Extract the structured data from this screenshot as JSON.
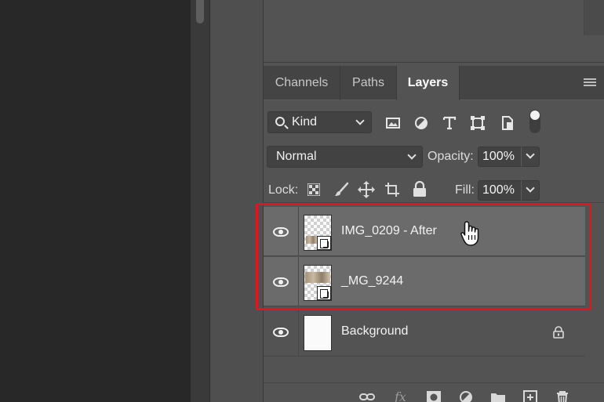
{
  "tabs": [
    {
      "label": "Channels",
      "active": false
    },
    {
      "label": "Paths",
      "active": false
    },
    {
      "label": "Layers",
      "active": true
    }
  ],
  "filter": {
    "kind_label": "Kind",
    "icons": [
      "image-filter-icon",
      "adjustment-filter-icon",
      "type-filter-icon",
      "shape-filter-icon",
      "smart-object-filter-icon"
    ]
  },
  "blend": {
    "mode": "Normal",
    "opacity_label": "Opacity:",
    "opacity_value": "100%"
  },
  "lock": {
    "label": "Lock:",
    "fill_label": "Fill:",
    "fill_value": "100%"
  },
  "layers": [
    {
      "name": "IMG_0209 - After",
      "selected": true,
      "visible": true,
      "smart_object": true,
      "locked": false
    },
    {
      "name": "_MG_9244",
      "selected": true,
      "visible": true,
      "smart_object": true,
      "locked": false
    },
    {
      "name": "Background",
      "selected": false,
      "visible": true,
      "smart_object": false,
      "locked": true
    }
  ],
  "bottom_icons": [
    "link-layers-icon",
    "fx-icon",
    "add-mask-icon",
    "adjustment-layer-icon",
    "new-group-icon",
    "new-layer-icon",
    "delete-layer-icon"
  ],
  "colors": {
    "highlight": "#e0161c",
    "panel_bg": "#535353",
    "selected_layer": "#6b6b6b"
  }
}
